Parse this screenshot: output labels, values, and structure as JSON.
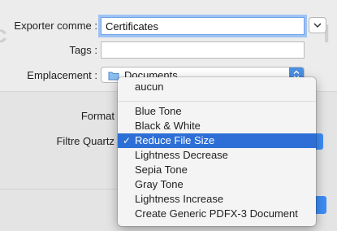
{
  "form": {
    "export_as_label": "Exporter comme :",
    "export_as_value": "Certificates",
    "tags_label": "Tags :",
    "tags_value": "",
    "location_label": "Emplacement :",
    "location_value": "Documents",
    "format_label": "Format",
    "quartz_filter_label": "Filtre Quartz"
  },
  "menu": {
    "items": [
      {
        "label": "aucun",
        "selected": false
      },
      {
        "label": "Blue Tone",
        "selected": false
      },
      {
        "label": "Black & White",
        "selected": false
      },
      {
        "label": "Reduce File Size",
        "selected": true
      },
      {
        "label": "Lightness Decrease",
        "selected": false
      },
      {
        "label": "Sepia Tone",
        "selected": false
      },
      {
        "label": "Gray Tone",
        "selected": false
      },
      {
        "label": "Lightness Increase",
        "selected": false
      },
      {
        "label": "Create Generic PDFX-3 Document",
        "selected": false
      }
    ],
    "checkmark": "✓"
  },
  "colors": {
    "accent": "#3d8df6",
    "selection": "#2d6fd6"
  }
}
